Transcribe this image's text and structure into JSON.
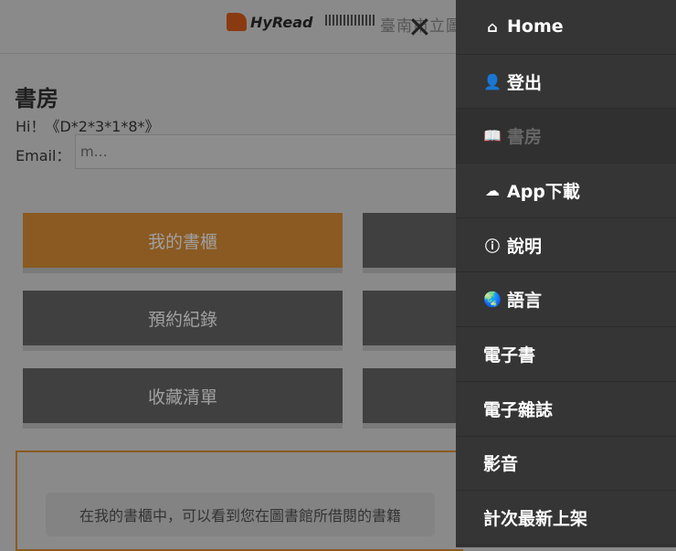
{
  "header": {
    "logo_hyread": "HyRead",
    "logo_library": "臺南市立圖書館",
    "close_icon": "close-icon"
  },
  "main": {
    "title": "書房",
    "greeting": "Hi！《D*2*3*1*8*》",
    "email_label": "Email：",
    "email_value": "m…",
    "buttons": [
      "我的書櫃",
      "預約紀錄",
      "收藏清單"
    ],
    "hint": "在我的書櫃中，可以看到您在圖書館所借閱的書籍"
  },
  "colors": {
    "accent": "#e0922e",
    "sidebar": "#353535"
  },
  "sidebar": {
    "items": [
      {
        "label": "Home",
        "icon": "home-icon"
      },
      {
        "label": "登出",
        "icon": "user-times-icon"
      },
      {
        "label": "書房",
        "icon": "book-open-icon"
      },
      {
        "label": "App下載",
        "icon": "cloud-download-icon"
      },
      {
        "label": "說明",
        "icon": "info-icon"
      },
      {
        "label": "語言",
        "icon": "globe-icon"
      },
      {
        "label": "電子書"
      },
      {
        "label": "電子雜誌"
      },
      {
        "label": "影音"
      },
      {
        "label": "計次最新上架"
      }
    ]
  }
}
